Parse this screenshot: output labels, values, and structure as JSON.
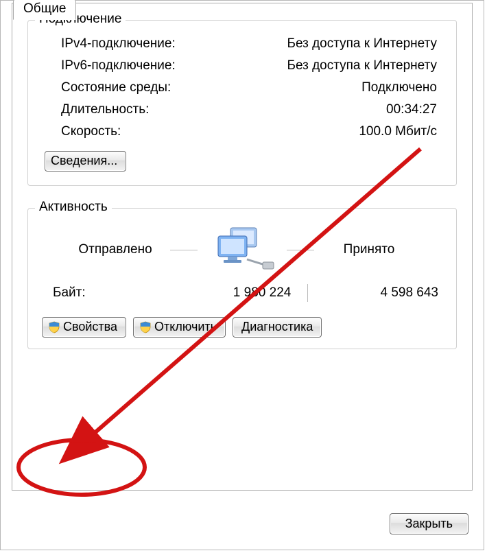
{
  "tabs": {
    "general": "Общие"
  },
  "connection": {
    "title": "Подключение",
    "ipv4_label": "IPv4-подключение:",
    "ipv4_value": "Без доступа к Интернету",
    "ipv6_label": "IPv6-подключение:",
    "ipv6_value": "Без доступа к Интернету",
    "media_label": "Состояние среды:",
    "media_value": "Подключено",
    "duration_label": "Длительность:",
    "duration_value": "00:34:27",
    "speed_label": "Скорость:",
    "speed_value": "100.0 Мбит/с",
    "details_btn": "Сведения..."
  },
  "activity": {
    "title": "Активность",
    "sent": "Отправлено",
    "received": "Принято",
    "bytes_label": "Байт:",
    "bytes_sent": "1 980 224",
    "bytes_received": "4 598 643"
  },
  "buttons": {
    "properties": "Свойства",
    "disable": "Отключить",
    "diagnose": "Диагностика",
    "close": "Закрыть"
  }
}
